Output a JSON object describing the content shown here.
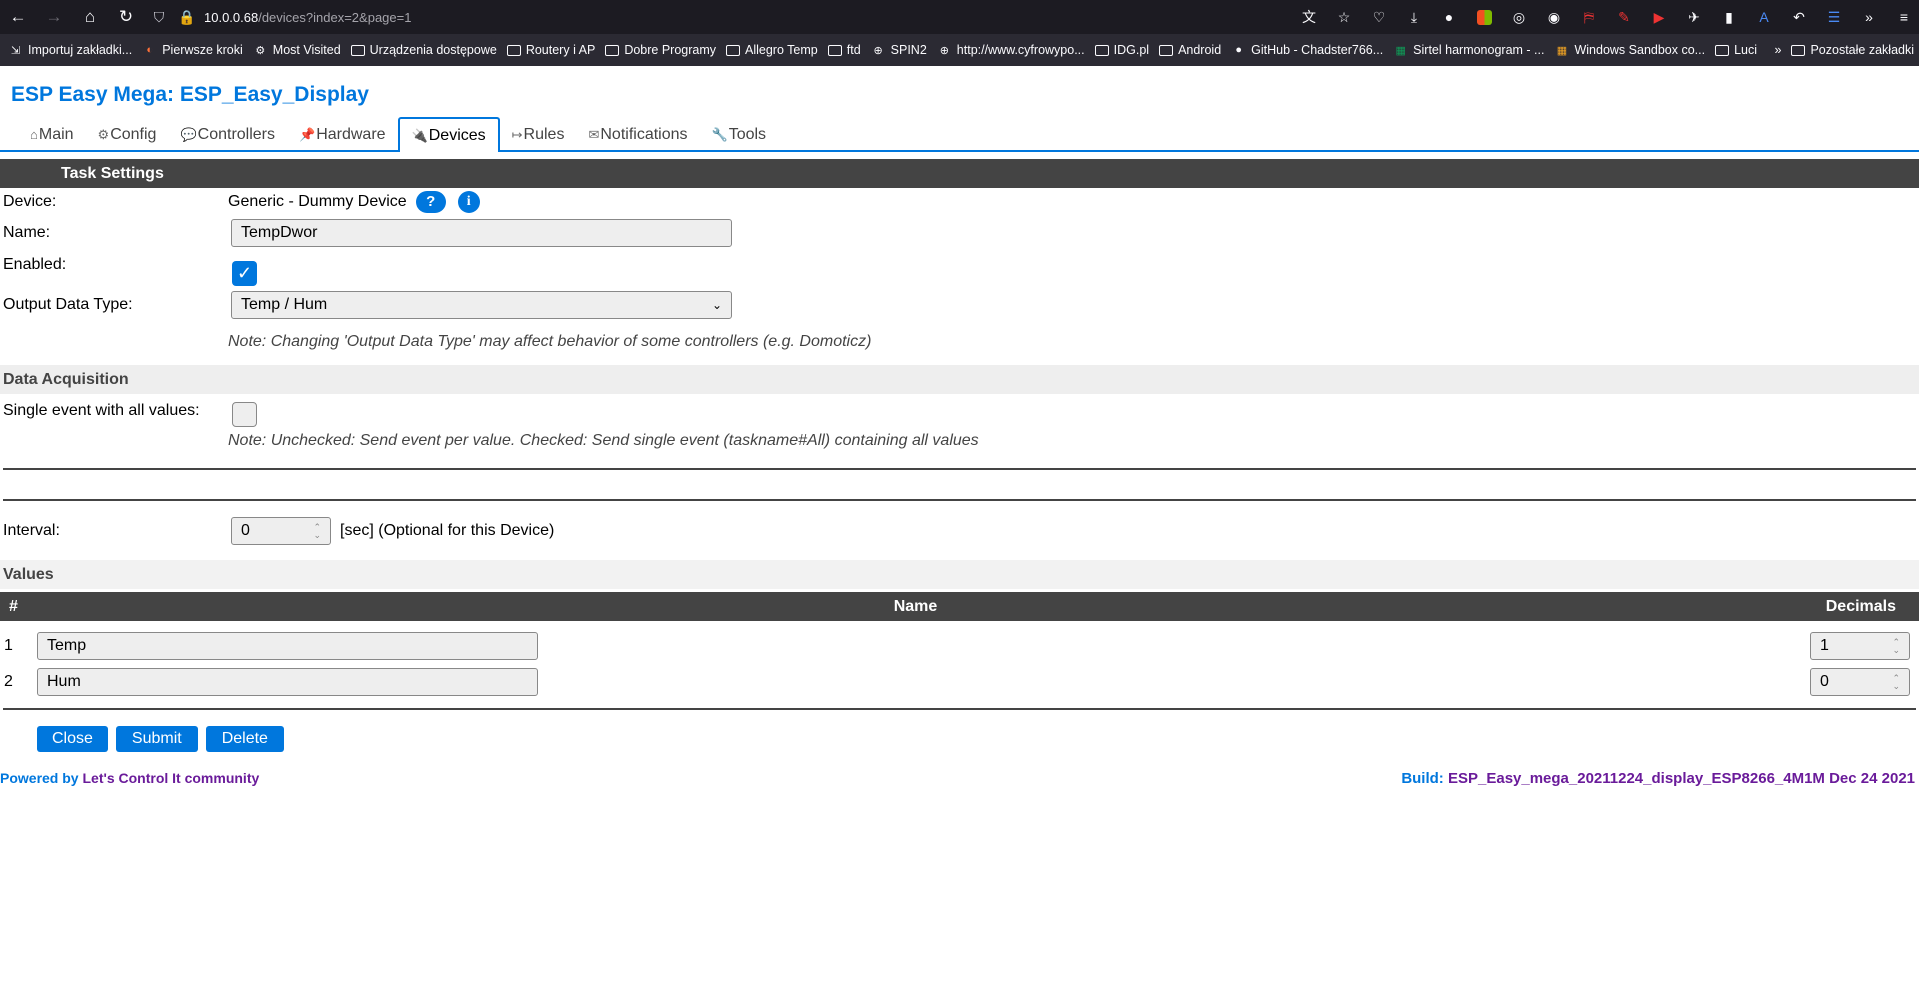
{
  "browser": {
    "url_host": "10.0.0.68",
    "url_path": "/devices?index=2&page=1",
    "bookmarks": [
      {
        "label": "Importuj zakładki...",
        "icon": "import-icon",
        "type": "item"
      },
      {
        "label": "Pierwsze kroki",
        "icon": "firefox-icon",
        "type": "item"
      },
      {
        "label": "Most Visited",
        "icon": "gear-icon",
        "type": "item"
      },
      {
        "label": "Urządzenia dostępowe",
        "icon": "folder-icon",
        "type": "folder"
      },
      {
        "label": "Routery i AP",
        "icon": "folder-icon",
        "type": "folder"
      },
      {
        "label": "Dobre Programy",
        "icon": "folder-icon",
        "type": "folder"
      },
      {
        "label": "Allegro Temp",
        "icon": "folder-icon",
        "type": "folder"
      },
      {
        "label": "ftd",
        "icon": "folder-icon",
        "type": "folder"
      },
      {
        "label": "SPIN2",
        "icon": "globe-icon",
        "type": "item"
      },
      {
        "label": "http://www.cyfrowypo...",
        "icon": "globe-icon",
        "type": "item"
      },
      {
        "label": "IDG.pl",
        "icon": "folder-icon",
        "type": "folder"
      },
      {
        "label": "Android",
        "icon": "folder-icon",
        "type": "folder"
      },
      {
        "label": "GitHub - Chadster766...",
        "icon": "github-icon",
        "type": "item"
      },
      {
        "label": "Sirtel harmonogram - ...",
        "icon": "sheets-icon",
        "type": "item"
      },
      {
        "label": "Windows Sandbox co...",
        "icon": "windows-icon",
        "type": "item"
      },
      {
        "label": "Luci",
        "icon": "folder-icon",
        "type": "folder"
      }
    ],
    "other_bookmarks": "Pozostałe zakładki"
  },
  "app": {
    "title": "ESP Easy Mega: ESP_Easy_Display"
  },
  "menu": [
    {
      "label": "Main",
      "icon": "⌂"
    },
    {
      "label": "Config",
      "icon": "⚙"
    },
    {
      "label": "Controllers",
      "icon": "💬"
    },
    {
      "label": "Hardware",
      "icon": "📌"
    },
    {
      "label": "Devices",
      "icon": "🔌"
    },
    {
      "label": "Rules",
      "icon": "↦"
    },
    {
      "label": "Notifications",
      "icon": "✉"
    },
    {
      "label": "Tools",
      "icon": "🔧"
    }
  ],
  "task": {
    "header": "Task Settings",
    "device_label": "Device:",
    "device_value": "Generic - Dummy Device",
    "help_glyph": "?",
    "info_glyph": "i",
    "name_label": "Name:",
    "name_value": "TempDwor",
    "enabled_label": "Enabled:",
    "enabled": true,
    "output_label": "Output Data Type:",
    "output_value": "Temp / Hum",
    "output_note": "Note: Changing 'Output Data Type' may affect behavior of some controllers (e.g. Domoticz)"
  },
  "acquisition": {
    "header": "Data Acquisition",
    "single_event_label": "Single event with all values:",
    "single_event": false,
    "single_event_note": "Note: Unchecked: Send event per value. Checked: Send single event (taskname#All) containing all values",
    "interval_label": "Interval:",
    "interval_value": "0",
    "interval_suffix": "[sec] (Optional for this Device)"
  },
  "values": {
    "header": "Values",
    "col_num": "#",
    "col_name": "Name",
    "col_decimals": "Decimals",
    "rows": [
      {
        "num": "1",
        "name": "Temp",
        "decimals": "1"
      },
      {
        "num": "2",
        "name": "Hum",
        "decimals": "0"
      }
    ]
  },
  "buttons": {
    "close": "Close",
    "submit": "Submit",
    "delete": "Delete"
  },
  "footer": {
    "powered_by": "Powered by",
    "community": "Let's Control It community",
    "build_label": "Build:",
    "build_value": "ESP_Easy_mega_20211224_display_ESP8266_4M1M Dec 24 2021"
  },
  "colors": {
    "accent": "#0077dd",
    "purple": "#6a1b9a",
    "header_bg": "#444444"
  }
}
